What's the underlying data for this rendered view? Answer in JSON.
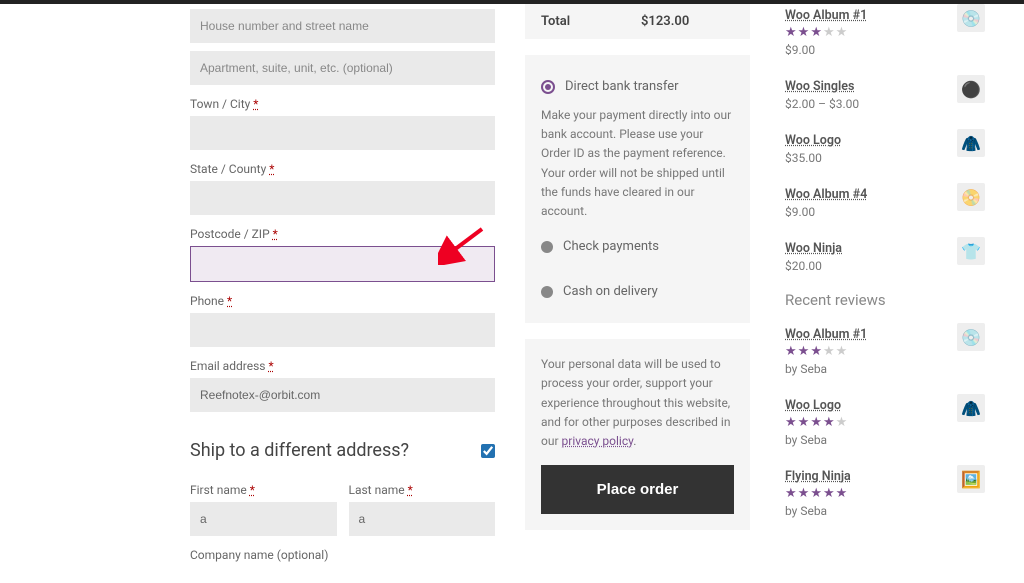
{
  "billing": {
    "street_placeholder": "House number and street name",
    "apt_placeholder": "Apartment, suite, unit, etc. (optional)",
    "town_label": "Town / City",
    "state_label": "State / County",
    "postcode_label": "Postcode / ZIP",
    "phone_label": "Phone",
    "email_label": "Email address",
    "email_value": "Reefnotex-@orbit.com"
  },
  "shipping": {
    "heading": "Ship to a different address?",
    "first_label": "First name",
    "last_label": "Last name",
    "first_value": "a",
    "last_value": "a",
    "company_label": "Company name (optional)"
  },
  "order": {
    "total_label": "Total",
    "total_value": "$123.00"
  },
  "payment": {
    "bank_label": "Direct bank transfer",
    "bank_desc": "Make your payment directly into our bank account. Please use your Order ID as the payment reference. Your order will not be shipped until the funds have cleared in our account.",
    "check_label": "Check payments",
    "cod_label": "Cash on delivery",
    "privacy_text": "Your personal data will be used to process your order, support your experience throughout this website, and for other purposes described in our ",
    "privacy_link": "privacy policy",
    "place_order": "Place order"
  },
  "products": [
    {
      "name": "Woo Album #1",
      "price": "$9.00",
      "stars": 3,
      "thumb": "disc"
    },
    {
      "name": "Woo Singles",
      "price": "$2.00 – $3.00",
      "stars": 0,
      "thumb": "vinyl"
    },
    {
      "name": "Woo Logo",
      "price": "$35.00",
      "stars": 0,
      "thumb": "hoodie"
    },
    {
      "name": "Woo Album #4",
      "price": "$9.00",
      "stars": 0,
      "thumb": "disc2"
    },
    {
      "name": "Woo Ninja",
      "price": "$20.00",
      "stars": 0,
      "thumb": "tee"
    }
  ],
  "reviews_heading": "Recent reviews",
  "reviews": [
    {
      "name": "Woo Album #1",
      "stars": 3,
      "by": "by Seba",
      "thumb": "disc"
    },
    {
      "name": "Woo Logo",
      "stars": 4,
      "by": "by Seba",
      "thumb": "hoodie"
    },
    {
      "name": "Flying Ninja",
      "stars": 5,
      "by": "by Seba",
      "thumb": "poster"
    }
  ],
  "required": "*"
}
